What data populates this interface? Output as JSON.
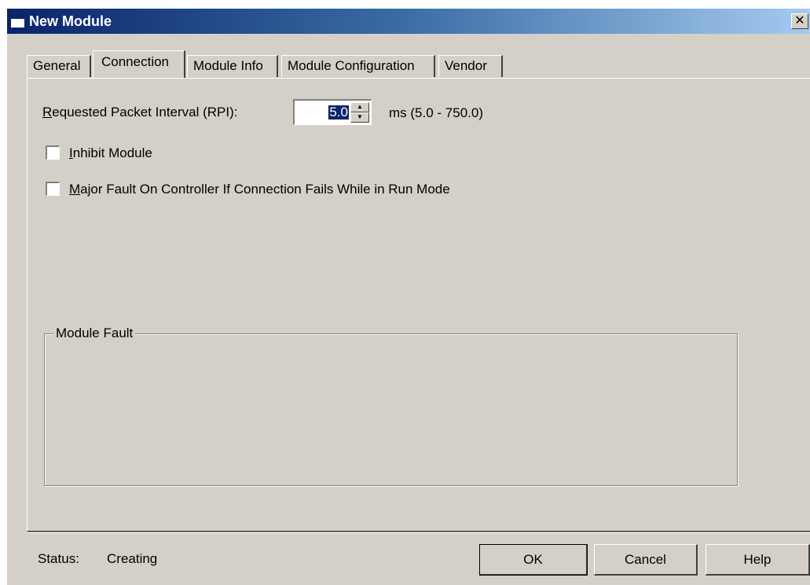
{
  "window": {
    "title": "New Module",
    "close_glyph": "✕"
  },
  "tabs": [
    {
      "label": "General",
      "active": false
    },
    {
      "label": "Connection",
      "active": true
    },
    {
      "label": "Module Info",
      "active": false
    },
    {
      "label": "Module Configuration",
      "active": false
    },
    {
      "label": "Vendor",
      "active": false
    }
  ],
  "connection": {
    "rpi_label_accel": "R",
    "rpi_label_rest": "equested Packet Interval (RPI):",
    "rpi_value": "5.0",
    "rpi_range": "ms (5.0 - 750.0)",
    "inhibit_accel": "I",
    "inhibit_rest": "nhibit Module",
    "inhibit_checked": false,
    "major_fault_accel": "M",
    "major_fault_rest": "ajor Fault On Controller If Connection Fails While in Run Mode",
    "major_fault_checked": false
  },
  "module_fault": {
    "label": "Module Fault",
    "text": ""
  },
  "status": {
    "label": "Status:",
    "value": "Creating"
  },
  "buttons": {
    "ok": "OK",
    "cancel": "Cancel",
    "help": "Help"
  }
}
